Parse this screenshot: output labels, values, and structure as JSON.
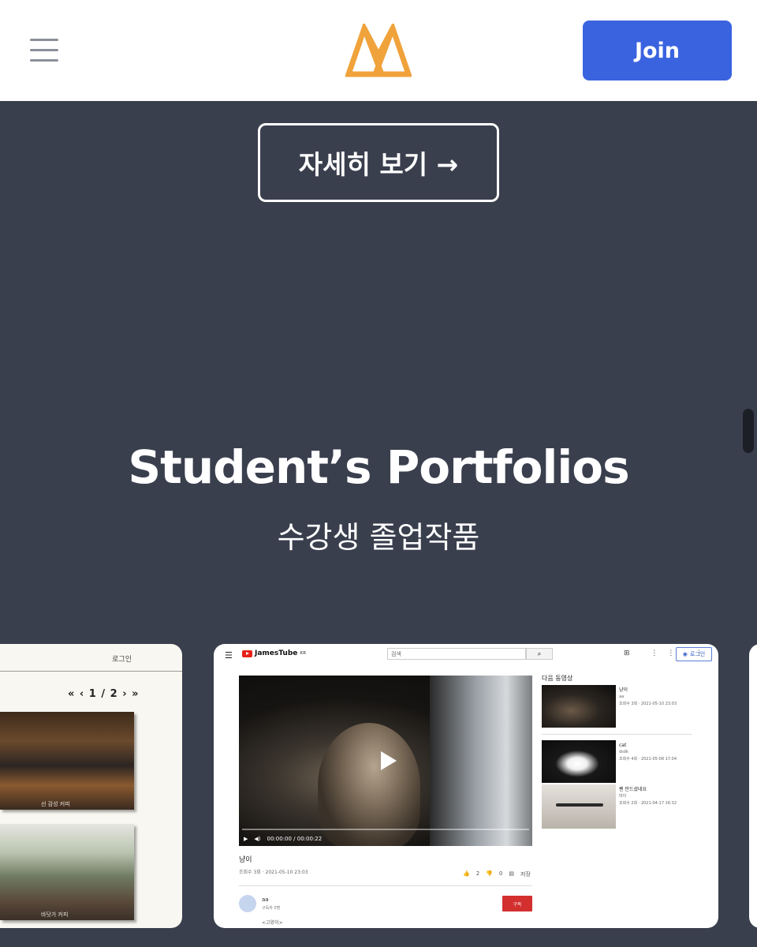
{
  "header": {
    "menu_icon": "hamburger-menu-icon",
    "logo_icon": "brand-logo-icon",
    "join_label": "Join",
    "colors": {
      "brand_orange": "#f0a23b",
      "join_blue": "#3a63e0",
      "background": "#3a3f4e"
    }
  },
  "hero": {
    "more_button": "자세히 보기 →"
  },
  "portfolios": {
    "title": "Student’s Portfolios",
    "subtitle": "수강생 졸업작품"
  },
  "left_card": {
    "login": "로그인",
    "pager": "« ‹ 1 / 2 › »",
    "caption1": "선 감성 커피",
    "caption2": "바닷가 커피"
  },
  "main_card": {
    "brand": "JamesTube",
    "brand_sup": "KR",
    "search_placeholder": "검색",
    "login": "로그인",
    "video_time": "00:00:00 / 00:00:22",
    "video_title": "냥이",
    "video_meta": "조회수 3회 · 2021-05-10 23:03",
    "likes": "2",
    "dislikes": "0",
    "save": "저장",
    "channel": "aa",
    "subscribers": "구독자 0명",
    "description": "<고양이>",
    "subscribe": "구독",
    "next_title": "다음 동영상",
    "next": [
      {
        "title": "냥이",
        "channel": "aa",
        "meta": "조회수 3회 · 2021-05-10 23:03"
      },
      {
        "title": "cat",
        "channel": "dsdk",
        "meta": "조회수 4회 · 2021-05-08 17:04"
      },
      {
        "title": "펜 만드셨네요",
        "channel": "마이",
        "meta": "조회수 2회 · 2021-04-17 16:32"
      }
    ]
  }
}
